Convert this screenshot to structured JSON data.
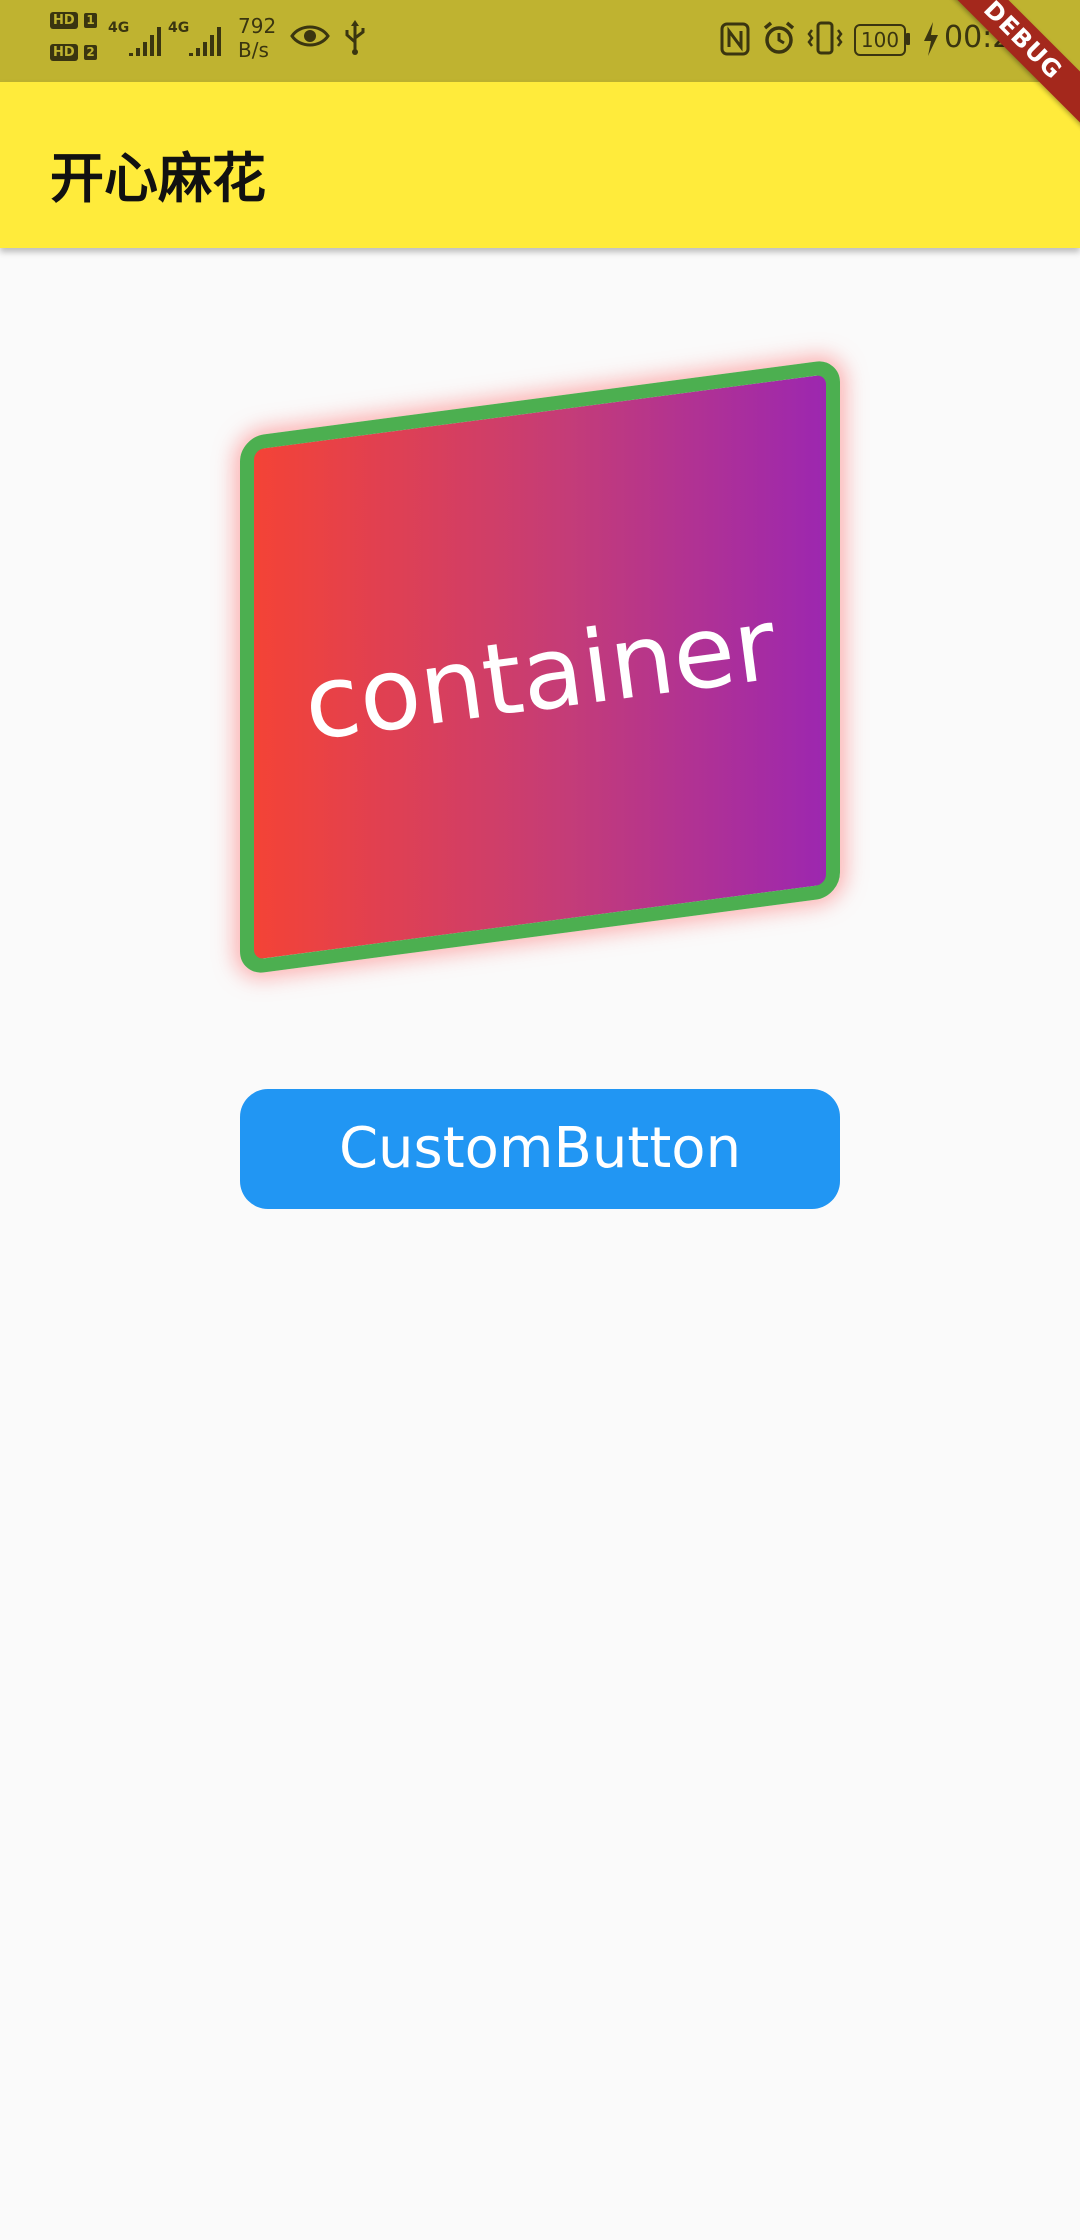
{
  "status_bar": {
    "hd_badge": "HD",
    "sim1": "1",
    "sim2": "2",
    "net1": "4G",
    "net2": "4G",
    "speed_value": "792",
    "speed_unit": "B/s",
    "battery_level": "100",
    "time": "00:26",
    "icons": [
      "eye-icon",
      "usb-icon",
      "nfc-icon",
      "alarm-icon",
      "vibrate-icon",
      "battery-icon",
      "charging-bolt-icon"
    ],
    "background_color": "#bfb330"
  },
  "debug_banner": {
    "label": "DEBUG"
  },
  "app_bar": {
    "title": "开心麻花",
    "color": "#ffeb3b"
  },
  "card": {
    "text": "container",
    "border_color": "#4caf50",
    "gradient_start": "#f44336",
    "gradient_end": "#9c27b0"
  },
  "button": {
    "label": "CustomButton",
    "color": "#2196f3"
  }
}
